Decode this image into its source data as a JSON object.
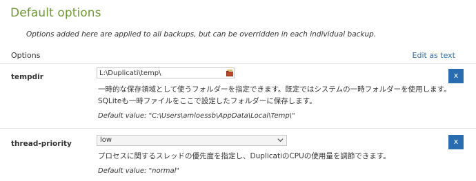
{
  "page": {
    "title": "Default options",
    "intro": "Options added here are applied to all backups, but can be overridden in each individual backup.",
    "options_label": "Options",
    "edit_as_text": "Edit as text"
  },
  "options": [
    {
      "name": "tempdir",
      "value": "L:\\Duplicati\\temp\\",
      "description_lines": [
        "一時的な保存領域として使うフォルダーを指定できます。既定ではシステムの一時フォルダーを使用します。",
        "SQLiteも一時ファイルをここで設定したフォルダーに保存します。"
      ],
      "default": "Default value: \"C:\\Users\\amloessb\\AppData\\Local\\Temp\\\"",
      "remove_label": "x"
    },
    {
      "name": "thread-priority",
      "selected": "low",
      "description_lines": [
        "プロセスに関するスレッドの優先度を指定し、DuplicatiのCPUの使用量を調節できます。"
      ],
      "default": "Default value: \"normal\"",
      "remove_label": "x"
    }
  ],
  "colors": {
    "title": "#6f9a32",
    "accent": "#2a6cb0",
    "link": "#2a6cb0"
  },
  "icons": {
    "folder_picker": "folder-browse-icon",
    "select_arrow": "chevron-down-icon"
  }
}
